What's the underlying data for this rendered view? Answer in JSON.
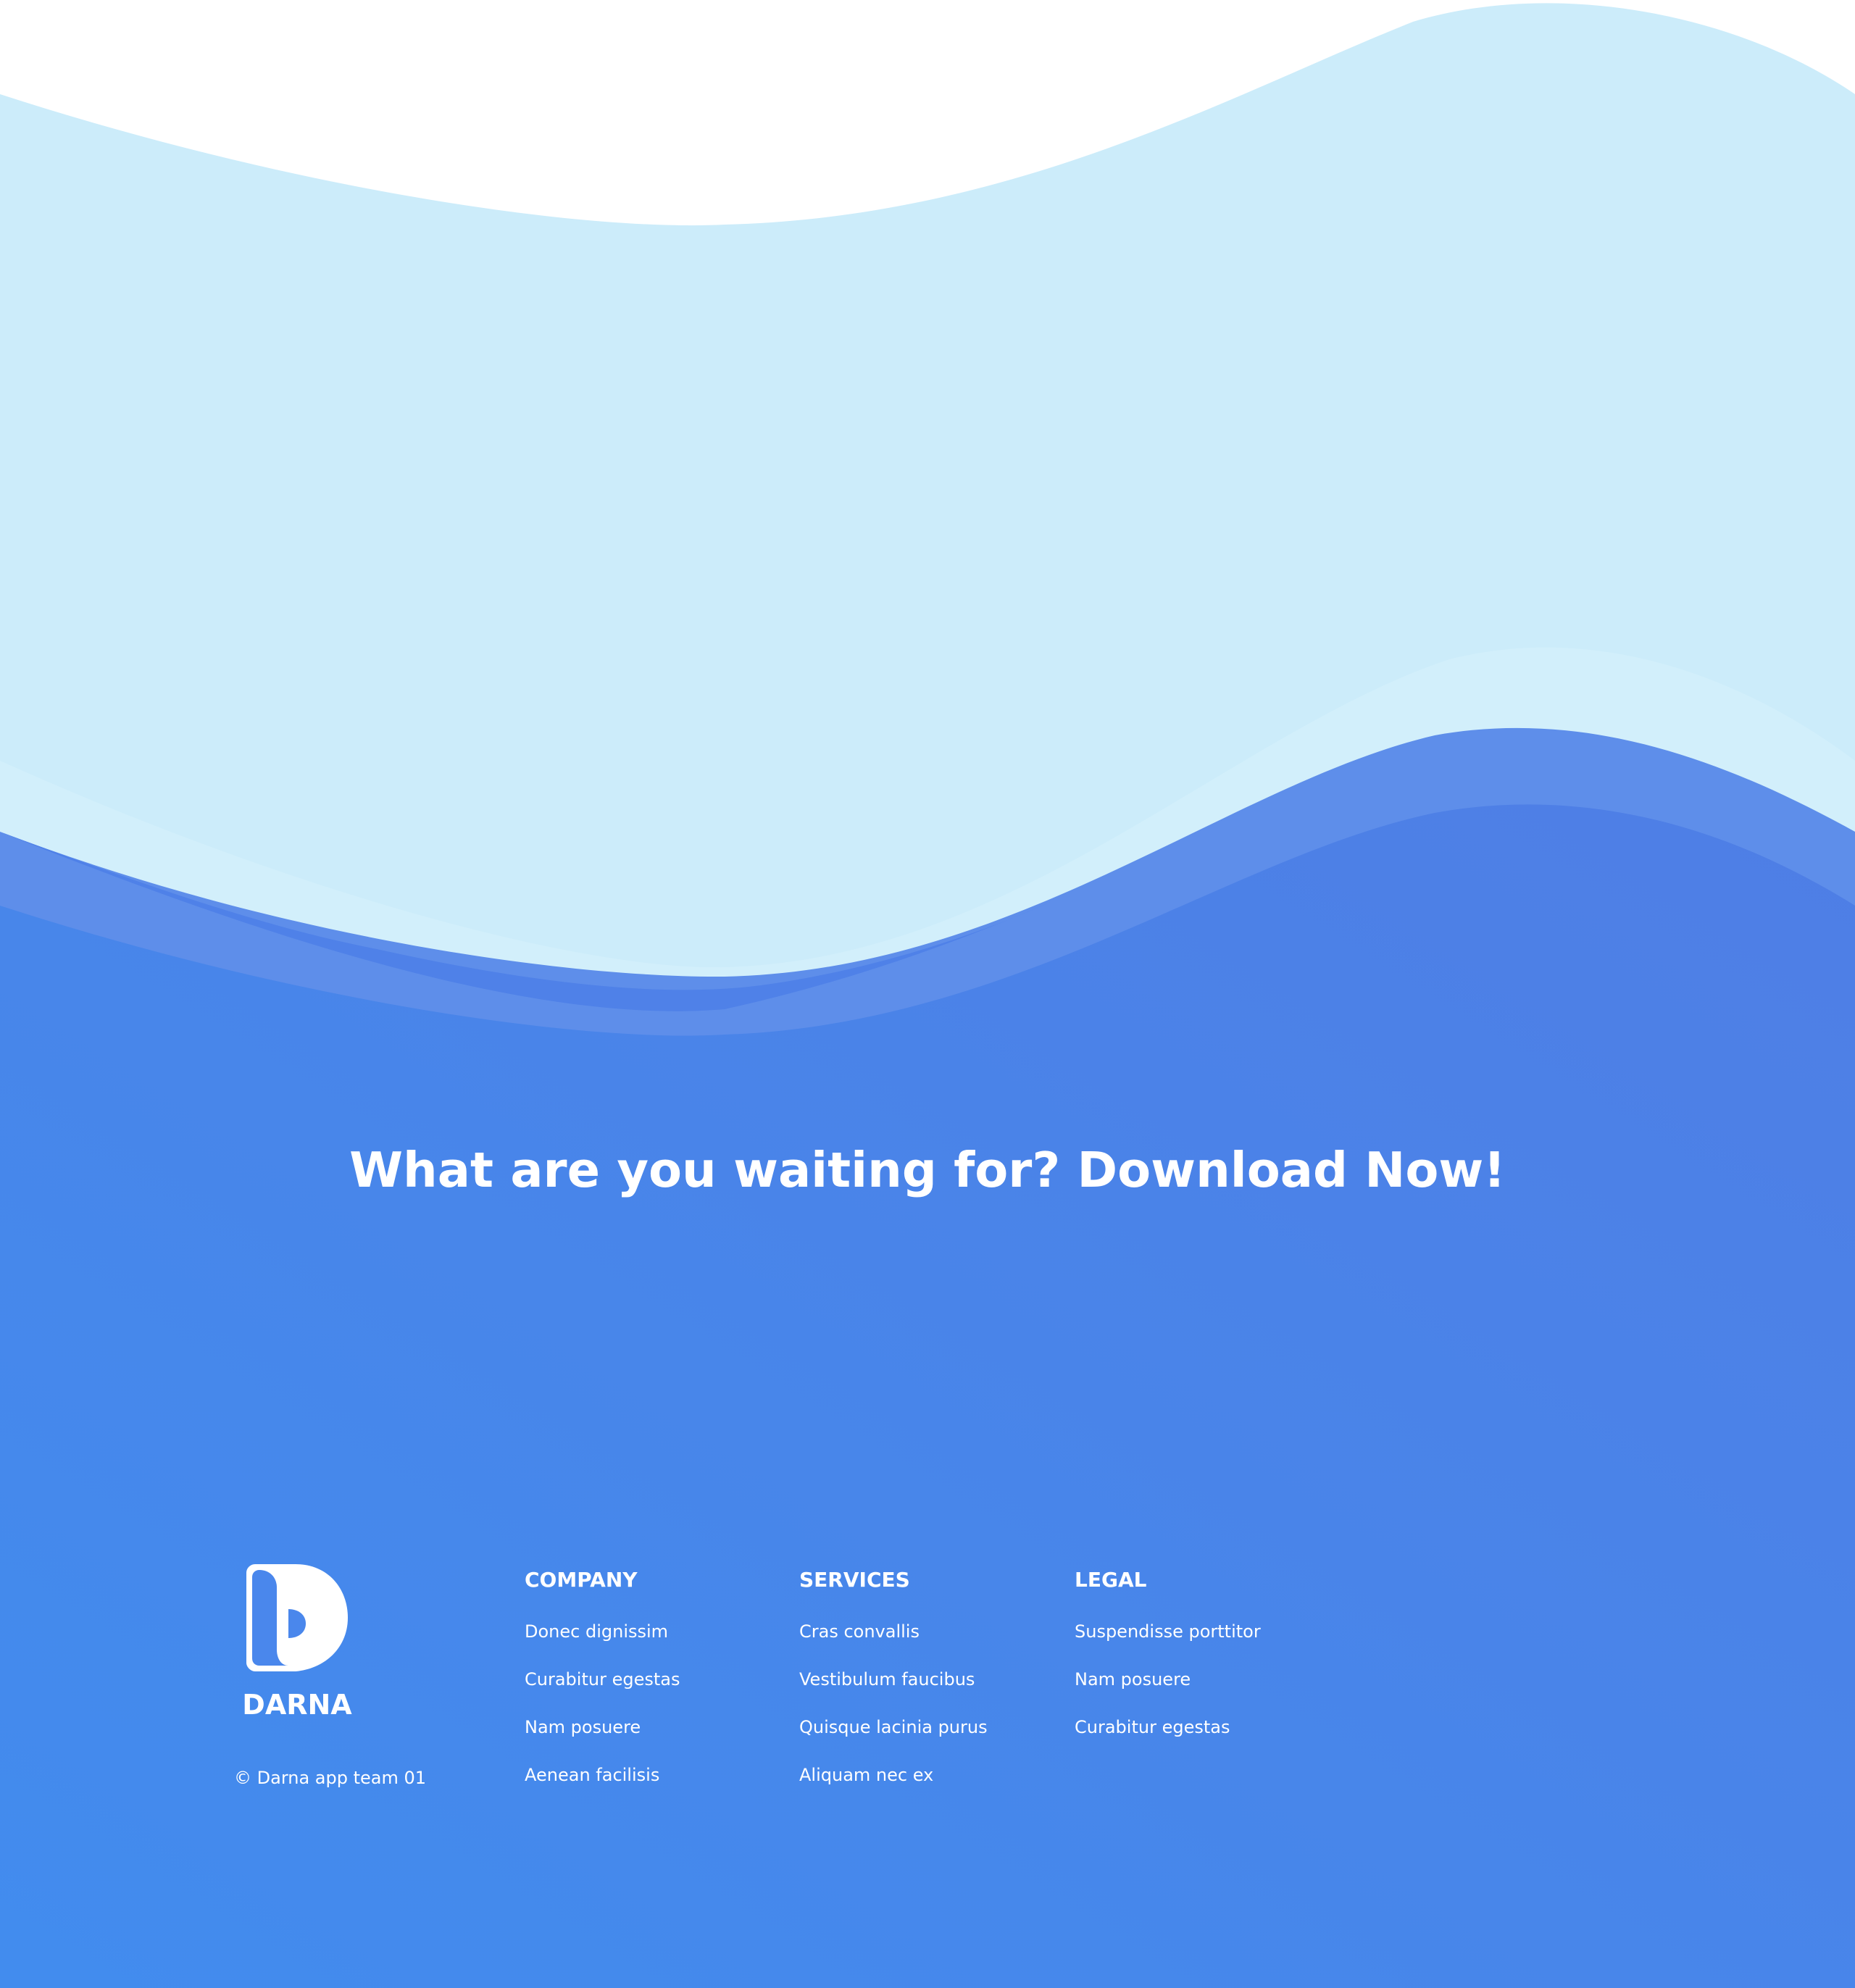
{
  "cta": {
    "title": "What are you waiting for? Download Now!"
  },
  "brand": {
    "name": "DARNA",
    "copyright": "© Darna app team 01",
    "logo_icon": "darna-d-logo"
  },
  "footer": {
    "columns": [
      {
        "heading": "COMPANY",
        "links": [
          "Donec dignissim",
          "Curabitur egestas",
          "Nam posuere",
          "Aenean facilisis"
        ]
      },
      {
        "heading": "SERVICES",
        "links": [
          "Cras convallis",
          "Vestibulum faucibus",
          "Quisque lacinia purus",
          "Aliquam nec ex"
        ]
      },
      {
        "heading": "LEGAL",
        "links": [
          "Suspendisse porttitor",
          "Nam posuere",
          "Curabitur egestas"
        ]
      }
    ]
  },
  "colors": {
    "light_wave": "#CCECFA",
    "mid_wave": "#5E8EEA",
    "deep_blue_start": "#428CEE",
    "deep_blue_end": "#4D80E6",
    "text": "#FFFFFF"
  }
}
